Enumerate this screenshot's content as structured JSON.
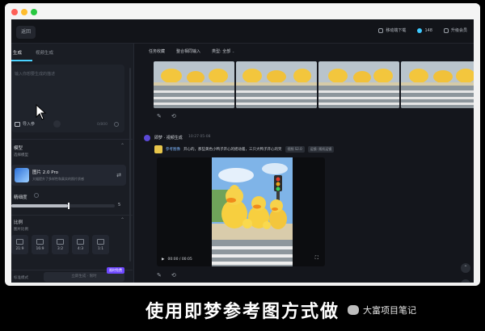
{
  "window": {
    "back_label": "返回"
  },
  "topbar": {
    "download_label": "移动端下载",
    "credits": "148",
    "member_label": "升级会员"
  },
  "left_panel": {
    "tabs": [
      "生成",
      "视频生成"
    ],
    "prompt_placeholder": "输入你想要生成的描述",
    "image_chip": "导入参",
    "char_count": "0/800",
    "section_model": "模型",
    "section_model_sub": "选择模型",
    "model_name": "图片 2.0 Pro",
    "model_desc": "大幅提升了多样性和真实的照片质感",
    "section_precision": "精细度",
    "slider_value": "5",
    "slider_fraction": 0.55,
    "section_ratio": "比例",
    "ratio_sub": "图片比例",
    "ratios": [
      "21:9",
      "16:9",
      "3:2",
      "4:3",
      "1:1"
    ],
    "gen_mode": "标准模式",
    "gen_button": "立即生成 · 限时",
    "promo": "限时免费"
  },
  "main": {
    "filters": [
      "任务收藏",
      "整合相同输入",
      "类型: 全部"
    ],
    "ai_name": "即梦 · 视频生成",
    "ai_time": "10:27  05-08",
    "ref_label": "参考图像",
    "prompt_text": "开心的，那些黄色小鸭子开心的摇动着，三只大鸭子开心的笑",
    "tags": [
      "视频 S2.0",
      "运镜: 随机运镜"
    ],
    "video_time": "00:00 / 00:05"
  },
  "caption": "使用即梦参考图方式做",
  "watermark": "大富项目笔记",
  "colors": {
    "accent": "#4ad2ff",
    "promo": "#6e48ff",
    "bg": "#14161c"
  }
}
